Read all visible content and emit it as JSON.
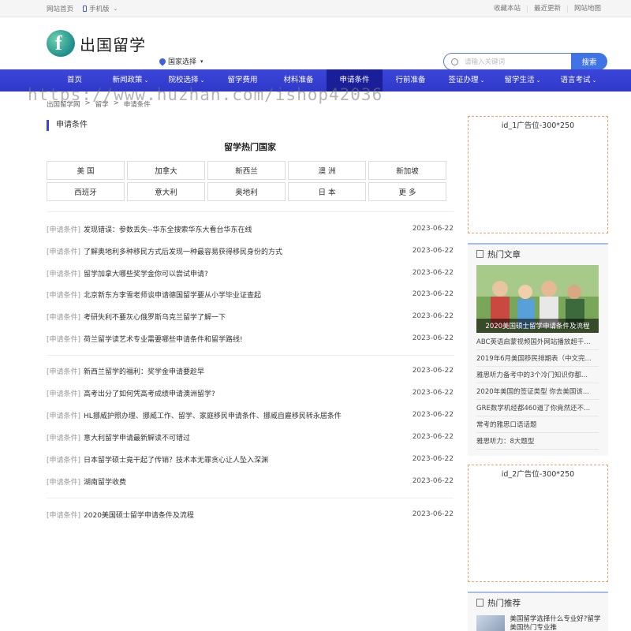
{
  "topbar": {
    "home": "网站首页",
    "mobile": "手机版",
    "links": [
      "收藏本站",
      "最近更新",
      "网站地图"
    ]
  },
  "header": {
    "logo_text": "出国留学",
    "country_select": "国家选择",
    "search_placeholder": "请输入关键词",
    "search_button": "搜索"
  },
  "nav": [
    {
      "label": "首页",
      "dropdown": false,
      "active": false
    },
    {
      "label": "新闻政策",
      "dropdown": true,
      "active": false
    },
    {
      "label": "院校选择",
      "dropdown": true,
      "active": false
    },
    {
      "label": "留学费用",
      "dropdown": false,
      "active": false
    },
    {
      "label": "材料准备",
      "dropdown": false,
      "active": false
    },
    {
      "label": "申请条件",
      "dropdown": false,
      "active": true
    },
    {
      "label": "行前准备",
      "dropdown": false,
      "active": false
    },
    {
      "label": "签证办理",
      "dropdown": true,
      "active": false
    },
    {
      "label": "留学生活",
      "dropdown": true,
      "active": false
    },
    {
      "label": "语言考试",
      "dropdown": true,
      "active": false
    }
  ],
  "watermark": "https://www.huzhan.com/ishop42036",
  "breadcrumb": [
    "出国留学网",
    ">",
    "留学",
    ">",
    "申请条件"
  ],
  "section_title": "申请条件",
  "hot_countries_title": "留学热门国家",
  "countries": [
    "美 国",
    "加拿大",
    "新西兰",
    "澳 洲",
    "新加坡",
    "西班牙",
    "意大利",
    "奥地利",
    "日 本",
    "更 多"
  ],
  "article_tag": "[申请条件]",
  "articles": [
    {
      "title": "发现错误：参数丢失--华东全搜索华东大看台华东在线",
      "date": "2023-06-22"
    },
    {
      "title": "了解奥地利多种移民方式后发现一种最容易获得移民身份的方式",
      "date": "2023-06-22"
    },
    {
      "title": "留学加拿大哪些奖学金你可以尝试申请?",
      "date": "2023-06-22"
    },
    {
      "title": "北京新东方李雪老师谈申请德国留学要从小学毕业证查起",
      "date": "2023-06-22"
    },
    {
      "title": "考研失利不要灰心俄罗斯乌克兰留学了解一下",
      "date": "2023-06-22"
    },
    {
      "title": "荷兰留学读艺术专业需要哪些申请条件和留学路线!",
      "date": "2023-06-22"
    },
    {
      "title": "新西兰留学的福利：奖学金申请要趁早",
      "date": "2023-06-22"
    },
    {
      "title": "高考出分了如何凭高考成绩申请澳洲留学?",
      "date": "2023-06-22"
    },
    {
      "title": "HL挪威护照办理、挪威工作、留学、家庭移民申请条件、挪威自雇移民转永居条件",
      "date": "2023-06-22"
    },
    {
      "title": "意大利留学申请最新解读不可错过",
      "date": "2023-06-22"
    },
    {
      "title": "日本留学硕士竟干起了传销？技术本无罪贪心让人坠入深渊",
      "date": "2023-06-22"
    },
    {
      "title": "湖南留学收费",
      "date": "2023-06-22"
    },
    {
      "title": "2020美国硕士留学申请条件及流程",
      "date": "2023-06-22"
    }
  ],
  "ads": [
    "id_1广告位-300*250",
    "id_2广告位-300*250"
  ],
  "hot_articles": {
    "title": "热门文章",
    "featured_caption": "2020美国硕士留学申请条件及流程",
    "items": [
      "ABC英语启蒙视频国外网站播放超千...",
      "2019年6月美国移民排期表（中文完...",
      "雅思听力备考中的3个冷门知识你都...",
      "2020年美国的签证类型 你去美国该...",
      "GRE数学机经都460道了你竟然还不...",
      "常考的雅思口语话题",
      "雅思听力：8大题型"
    ]
  },
  "hot_recommend": {
    "title": "热门推荐",
    "first_item": "美国留学选择什么专业好?留学美国热门专业推"
  },
  "colors": {
    "nav_bg": "#3b46d8",
    "nav_active": "#1a1f99",
    "accent": "#3f73e6",
    "ad_border": "#f0a060"
  }
}
